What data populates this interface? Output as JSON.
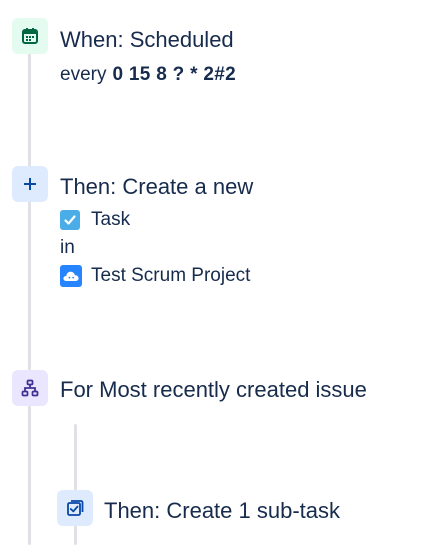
{
  "trigger": {
    "title": "When: Scheduled",
    "schedule_prefix": "every",
    "cron": "0 15 8 ? * 2#2",
    "icon": "calendar-icon"
  },
  "action_create": {
    "title": "Then: Create a new",
    "issue_type": "Task",
    "issue_type_icon": "task-checkbox-icon",
    "in_label": "in",
    "project": "Test Scrum Project",
    "project_icon": "cloud-project-icon",
    "icon": "plus-icon"
  },
  "branch": {
    "title": "For Most recently created issue",
    "icon": "branch-hierarchy-icon"
  },
  "sub_action": {
    "title": "Then: Create 1 sub-task",
    "icon": "subtask-icon"
  },
  "colors": {
    "text": "#172b4d",
    "rail": "#dfe1e6",
    "trigger_bg": "#e3fcef",
    "trigger_fg": "#006644",
    "action_bg": "#deebff",
    "action_fg": "#0747a6",
    "branch_bg": "#eae6ff",
    "branch_fg": "#403294"
  }
}
